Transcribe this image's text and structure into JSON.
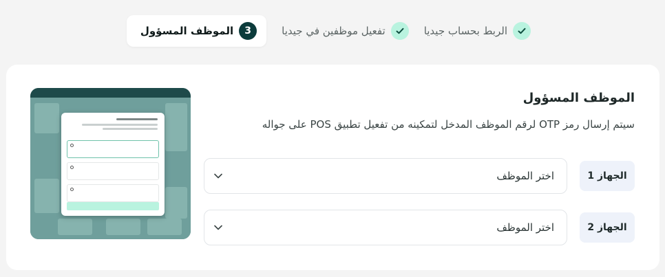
{
  "stepper": {
    "steps": [
      {
        "label": "الربط بحساب جيديا",
        "state": "done"
      },
      {
        "label": "تفعيل موظفين في جيديا",
        "state": "done"
      },
      {
        "label": "الموظف المسؤول",
        "state": "active",
        "number": "3"
      }
    ]
  },
  "section": {
    "title": "الموظف المسؤول",
    "description": "سيتم إرسال رمز OTP لرقم الموظف المدخل لتمكينه من تفعيل تطبيق POS على جواله"
  },
  "devices": [
    {
      "label": "الجهاز 1",
      "select_value": "اختر الموظف"
    },
    {
      "label": "الجهاز 2",
      "select_value": "اختر الموظف"
    }
  ],
  "icons": {
    "check": "check-icon",
    "dropdown": "chevron-down-icon"
  },
  "colors": {
    "step_done_bg": "#b9f3df",
    "step_active_bg": "#0b3b3b",
    "device_label_bg": "#eef2fa",
    "page_bg": "#f4f4f4"
  }
}
